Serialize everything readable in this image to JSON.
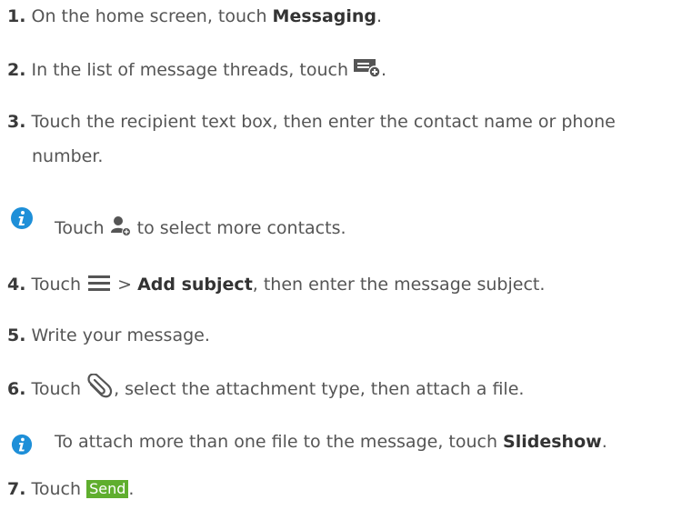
{
  "steps": [
    {
      "num": "1.",
      "a": "On the home screen, touch ",
      "b1": "Messaging",
      "c": "."
    },
    {
      "num": "2.",
      "a": "In the list of message threads, touch ",
      "c": "."
    },
    {
      "num": "3.",
      "a": "Touch the recipient text box, then enter the contact name or phone",
      "cont": "number."
    },
    {
      "num": "4.",
      "a": "Touch ",
      "gt": " > ",
      "b1": "Add subject",
      "c": ", then enter the message subject."
    },
    {
      "num": "5.",
      "a": "Write your message."
    },
    {
      "num": "6.",
      "a": "Touch ",
      "c": ", select the attachment type, then attach a file."
    },
    {
      "num": "7.",
      "a": "Touch ",
      "send": "Send",
      "c": "."
    }
  ],
  "notes": [
    {
      "a": "Touch ",
      "c": " to select more contacts."
    },
    {
      "a": "To attach more than one file to the message, touch ",
      "b1": "Slideshow",
      "c": "."
    }
  ],
  "colors": {
    "info_icon": "#1e8fd8",
    "send_button": "#5fae2e"
  },
  "icons": [
    "new-message-icon",
    "add-contact-icon",
    "menu-icon",
    "attachment-icon",
    "info-icon"
  ]
}
